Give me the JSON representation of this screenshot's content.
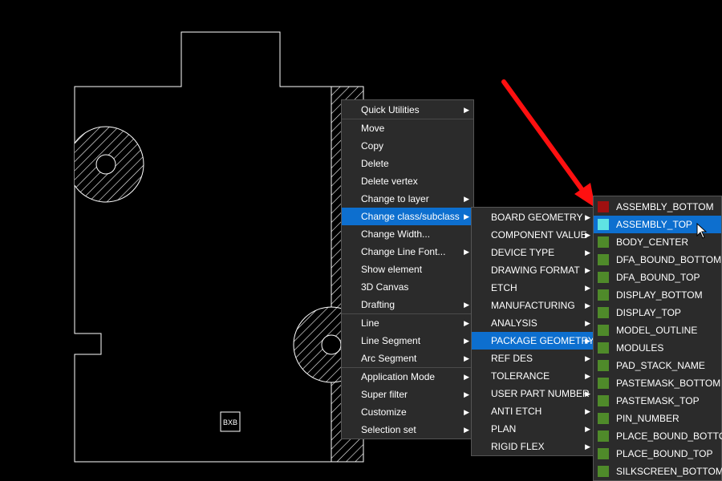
{
  "canvas": {
    "part_label": "BXB"
  },
  "context_menu": {
    "items": [
      {
        "label": "Quick Utilities",
        "submenu": true
      },
      {
        "separator": true
      },
      {
        "label": "Move"
      },
      {
        "label": "Copy"
      },
      {
        "label": "Delete"
      },
      {
        "label": "Delete vertex"
      },
      {
        "label": "Change to layer",
        "submenu": true
      },
      {
        "label": "Change class/subclass",
        "submenu": true,
        "selected": true
      },
      {
        "label": "Change Width..."
      },
      {
        "label": "Change Line Font...",
        "submenu": true
      },
      {
        "label": "Show element"
      },
      {
        "label": "3D Canvas"
      },
      {
        "label": "Drafting",
        "submenu": true
      },
      {
        "separator": true
      },
      {
        "label": "Line",
        "submenu": true
      },
      {
        "label": "Line Segment",
        "submenu": true
      },
      {
        "label": "Arc Segment",
        "submenu": true
      },
      {
        "separator": true
      },
      {
        "label": "Application Mode",
        "submenu": true
      },
      {
        "label": "Super filter",
        "submenu": true
      },
      {
        "label": "Customize",
        "submenu": true
      },
      {
        "label": "Selection set",
        "submenu": true
      }
    ]
  },
  "class_menu": {
    "items": [
      {
        "label": "BOARD GEOMETRY",
        "submenu": true
      },
      {
        "label": "COMPONENT VALUE",
        "submenu": true
      },
      {
        "label": "DEVICE TYPE",
        "submenu": true
      },
      {
        "label": "DRAWING FORMAT",
        "submenu": true
      },
      {
        "label": "ETCH",
        "submenu": true
      },
      {
        "label": "MANUFACTURING",
        "submenu": true
      },
      {
        "label": "ANALYSIS",
        "submenu": true
      },
      {
        "label": "PACKAGE GEOMETRY",
        "submenu": true,
        "selected": true
      },
      {
        "label": "REF DES",
        "submenu": true
      },
      {
        "label": "TOLERANCE",
        "submenu": true
      },
      {
        "label": "USER PART NUMBER",
        "submenu": true
      },
      {
        "label": "ANTI ETCH",
        "submenu": true
      },
      {
        "label": "PLAN",
        "submenu": true
      },
      {
        "label": "RIGID FLEX",
        "submenu": true
      }
    ]
  },
  "subclass_menu": {
    "items": [
      {
        "label": "ASSEMBLY_BOTTOM",
        "color": "#a01010"
      },
      {
        "label": "ASSEMBLY_TOP",
        "color": "#5fe3e3",
        "selected": true
      },
      {
        "label": "BODY_CENTER",
        "color": "#4f8a2a"
      },
      {
        "label": "DFA_BOUND_BOTTOM",
        "color": "#4f8a2a"
      },
      {
        "label": "DFA_BOUND_TOP",
        "color": "#4f8a2a"
      },
      {
        "label": "DISPLAY_BOTTOM",
        "color": "#4f8a2a"
      },
      {
        "label": "DISPLAY_TOP",
        "color": "#4f8a2a"
      },
      {
        "label": "MODEL_OUTLINE",
        "color": "#4f8a2a"
      },
      {
        "label": "MODULES",
        "color": "#4f8a2a"
      },
      {
        "label": "PAD_STACK_NAME",
        "color": "#4f8a2a"
      },
      {
        "label": "PASTEMASK_BOTTOM",
        "color": "#4f8a2a"
      },
      {
        "label": "PASTEMASK_TOP",
        "color": "#4f8a2a"
      },
      {
        "label": "PIN_NUMBER",
        "color": "#4f8a2a"
      },
      {
        "label": "PLACE_BOUND_BOTTOM",
        "color": "#4f8a2a"
      },
      {
        "label": "PLACE_BOUND_TOP",
        "color": "#4f8a2a"
      },
      {
        "label": "SILKSCREEN_BOTTOM",
        "color": "#4f8a2a"
      }
    ]
  },
  "colors": {
    "highlight": "#0d6fcf",
    "menu_bg": "#2b2b2b",
    "annotation_arrow": "#ff1010"
  }
}
